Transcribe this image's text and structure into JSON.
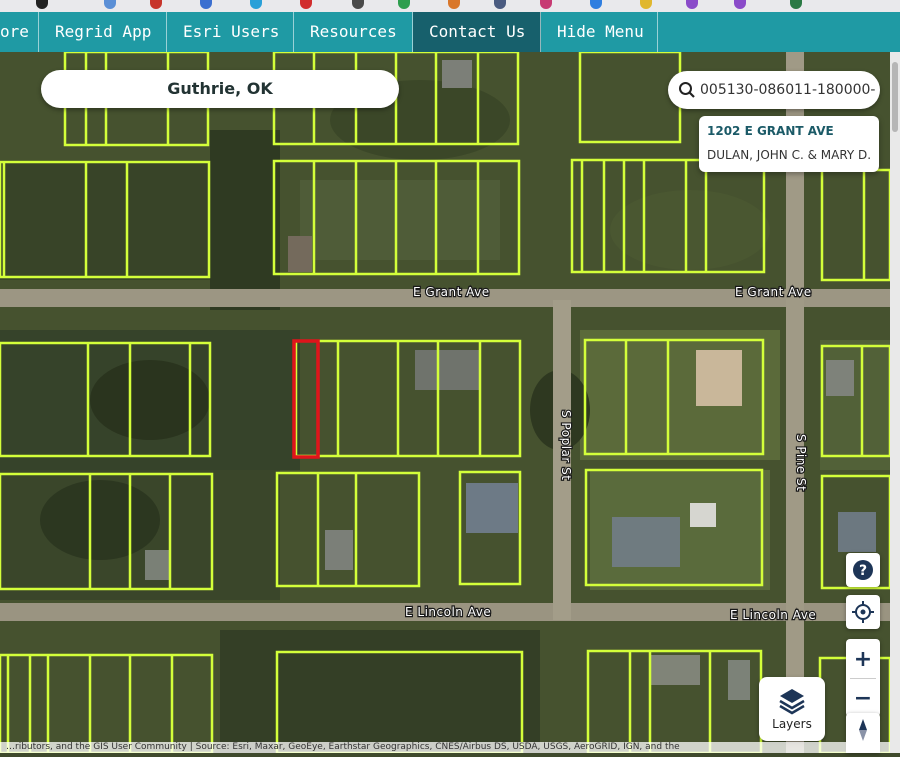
{
  "nav": {
    "items": [
      {
        "label": "ore",
        "active": false
      },
      {
        "label": "Regrid App",
        "active": false
      },
      {
        "label": "Esri Users",
        "active": false
      },
      {
        "label": "Resources",
        "active": false
      },
      {
        "label": "Contact Us",
        "active": true
      },
      {
        "label": "Hide Menu",
        "active": false
      }
    ]
  },
  "map": {
    "city": "Guthrie, OK",
    "search": {
      "value": "005130-086011-180000-"
    },
    "popup": {
      "address": "1202 E GRANT AVE",
      "owner": "DULAN, JOHN C. & MARY D."
    },
    "roads": {
      "grant_west": "E Grant Ave",
      "grant_east": "E Grant Ave",
      "lincoln_west": "E Lincoln Ave",
      "lincoln_east": "E Lincoln Ave",
      "poplar": "S Poplar St",
      "pine": "S Pine St"
    },
    "controls": {
      "help": "?",
      "zoom_in": "+",
      "zoom_out": "−",
      "layers": "Layers"
    },
    "attribution": "…ributors, and the GIS User Community | Source: Esri, Maxar, GeoEye, Earthstar Geographics, CNES/Airbus DS, USDA, USGS, AeroGRID, IGN, and the",
    "colors": {
      "parcel_outline": "#d4ff3a",
      "selected_parcel": "#e0141b",
      "nav_bg": "#1f9aa4",
      "nav_active": "#17606c"
    }
  }
}
